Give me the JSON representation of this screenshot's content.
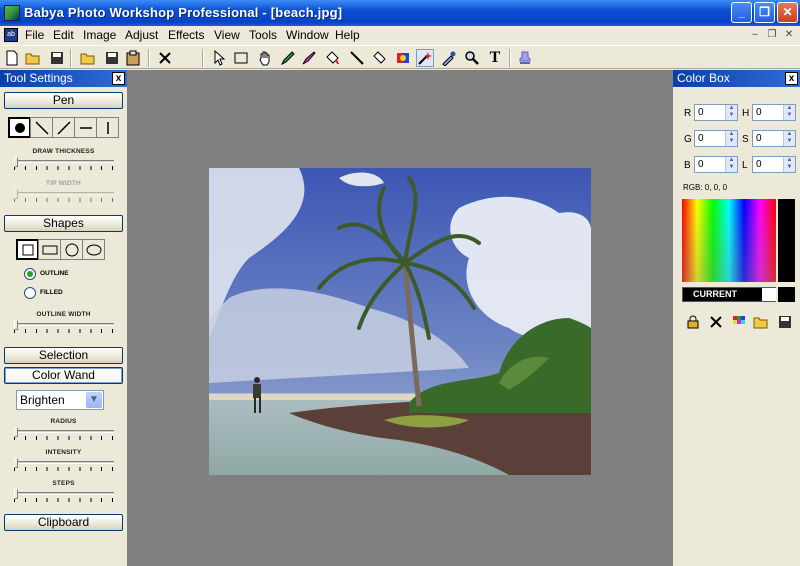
{
  "window": {
    "title": "Babya Photo Workshop Professional - [beach.jpg]",
    "minimize": "_",
    "restore": "❐",
    "close": "✕"
  },
  "menu": {
    "items": [
      "File",
      "Edit",
      "Image",
      "Adjust",
      "Effects",
      "View",
      "Tools",
      "Window",
      "Help"
    ],
    "doc_icon": "ab",
    "doc_minimize": "–",
    "doc_restore": "❐",
    "doc_close": "✕"
  },
  "toolbar": {
    "icons": [
      "new-file-icon",
      "open-folder-icon",
      "save-icon",
      "open-icon",
      "save-as-icon",
      "paste-icon",
      "cut-icon",
      "pointer-icon",
      "rect-select-icon",
      "hand-icon",
      "pen-icon",
      "brush-icon",
      "fill-icon",
      "line-icon",
      "eraser-icon",
      "color-replace-icon",
      "color-wand-icon",
      "eyedropper-icon",
      "zoom-icon",
      "text-icon",
      "stamp-icon"
    ],
    "text_tool": "T"
  },
  "tool_settings": {
    "title": "Tool Settings",
    "close": "x",
    "pen_label": "Pen",
    "draw_thickness_label": "DRAW THICKNESS",
    "tip_width_label": "TIP WIDTH",
    "shapes_label": "Shapes",
    "outline_label": "OUTLINE",
    "filled_label": "FILLED",
    "outline_width_label": "OUTLINE WIDTH",
    "selection_label": "Selection",
    "color_wand_label": "Color Wand",
    "brighten_value": "Brighten",
    "radius_label": "RADIUS",
    "intensity_label": "INTENSITY",
    "steps_label": "STEPS",
    "clipboard_label": "Clipboard",
    "fill_mode": "outline"
  },
  "color_box": {
    "title": "Color Box",
    "close": "x",
    "r_label": "R",
    "g_label": "G",
    "b_label": "B",
    "h_label": "H",
    "s_label": "S",
    "l_label": "L",
    "r": "0",
    "g": "0",
    "b": "0",
    "h": "0",
    "s": "0",
    "l": "0",
    "rgb_readout": "RGB: 0, 0, 0",
    "current_label": "CURRENT",
    "current_color": "#000000"
  },
  "colors": {
    "titlebar": "#0842c4",
    "canvas_bg": "#808080",
    "panel_bg": "#ece9d8"
  }
}
